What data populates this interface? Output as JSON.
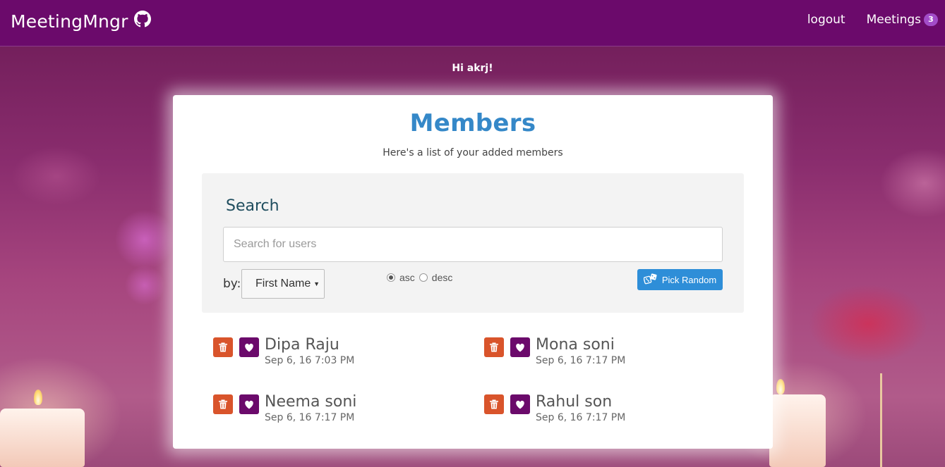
{
  "navbar": {
    "brand": "MeetingMngr",
    "links": [
      {
        "label": "logout"
      },
      {
        "label": "Meetings",
        "badge": "3"
      }
    ]
  },
  "greeting": "Hi akrj!",
  "card": {
    "title": "Members",
    "subtitle": "Here's a list of your added members"
  },
  "search": {
    "heading": "Search",
    "placeholder": "Search for users",
    "value": "",
    "by_label": "by:",
    "sort_field": "First Name",
    "order_options": [
      {
        "label": "asc",
        "checked": true
      },
      {
        "label": "desc",
        "checked": false
      }
    ],
    "pick_random_label": "Pick Random"
  },
  "members": [
    {
      "name": "Dipa Raju",
      "date": "Sep 6, 16 7:03 PM"
    },
    {
      "name": "Mona soni",
      "date": "Sep 6, 16 7:17 PM"
    },
    {
      "name": "Neema soni",
      "date": "Sep 6, 16 7:17 PM"
    },
    {
      "name": "Rahul son",
      "date": "Sep 6, 16 7:17 PM"
    }
  ],
  "colors": {
    "navbar": "#6b0a6b",
    "title": "#3588c8",
    "delete": "#d9542b",
    "favorite": "#6b0a6b",
    "primary_button": "#2e8ed8",
    "badge": "#a24cc8"
  }
}
